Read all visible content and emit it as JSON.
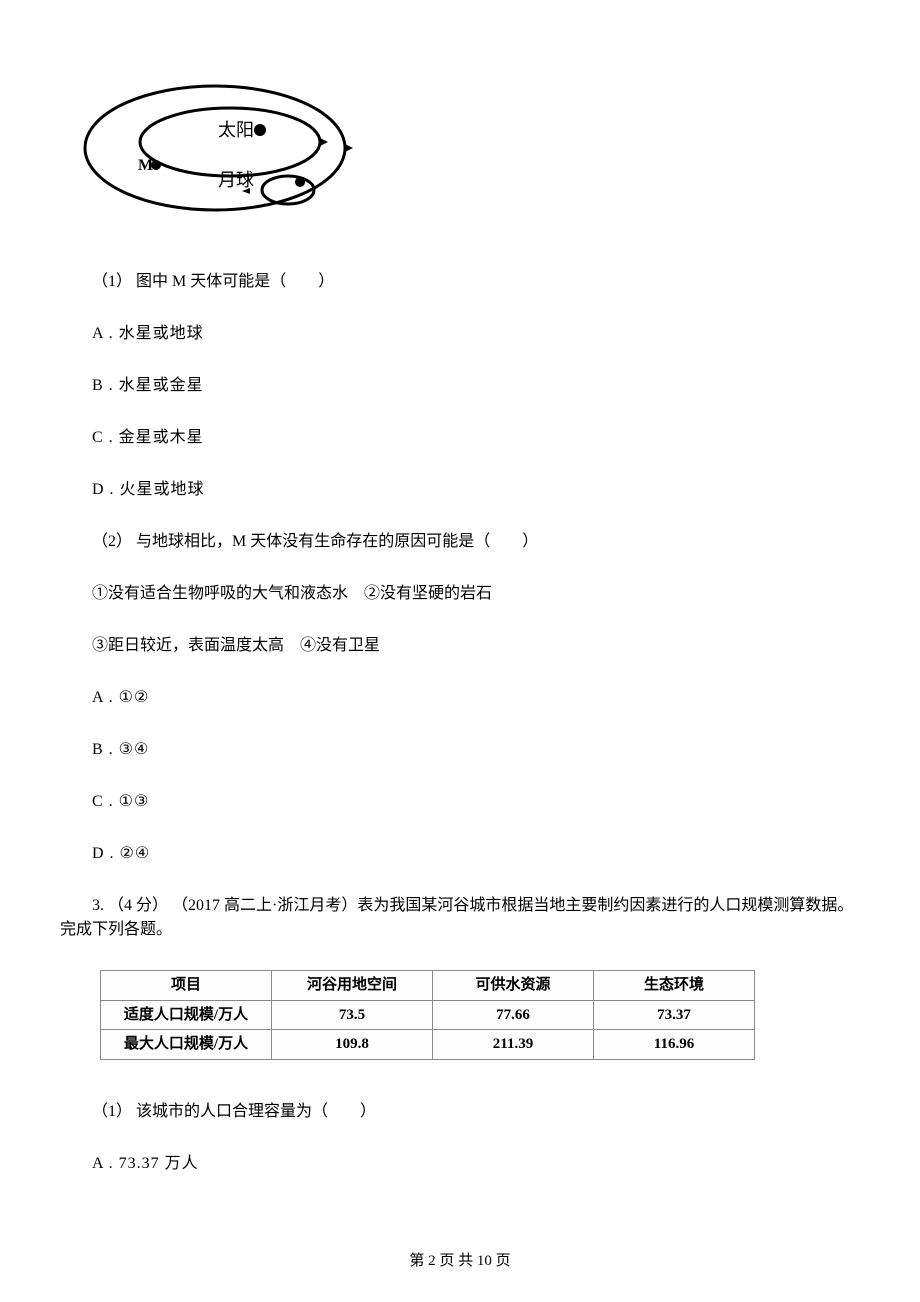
{
  "diagram": {
    "sun_label": "太阳",
    "moon_label": "月球",
    "m_label": "M"
  },
  "q2": {
    "sub1": {
      "prompt": "（1） 图中 M 天体可能是（　　）",
      "A": "A . 水星或地球",
      "B": "B . 水星或金星",
      "C": "C . 金星或木星",
      "D": "D . 火星或地球"
    },
    "sub2": {
      "prompt": "（2） 与地球相比，M 天体没有生命存在的原因可能是（　　）",
      "cond_line1": "①没有适合生物呼吸的大气和液态水　②没有坚硬的岩石",
      "cond_line2": "③距日较近，表面温度太高　④没有卫星",
      "A": "A . ①②",
      "B": "B . ③④",
      "C": "C . ①③",
      "D": "D . ②④"
    }
  },
  "q3": {
    "lead": "3. （4 分） （2017 高二上·浙江月考）表为我国某河谷城市根据当地主要制约因素进行的人口规模测算数据。完成下列各题。",
    "table": {
      "headers": [
        "项目",
        "河谷用地空间",
        "可供水资源",
        "生态环境"
      ],
      "rows": [
        {
          "label": "适度人口规模/万人",
          "v1": "73.5",
          "v2": "77.66",
          "v3": "73.37"
        },
        {
          "label": "最大人口规模/万人",
          "v1": "109.8",
          "v2": "211.39",
          "v3": "116.96"
        }
      ]
    },
    "sub1": {
      "prompt": "（1） 该城市的人口合理容量为（　　）",
      "A": "A . 73.37 万人"
    }
  },
  "footer": "第 2 页 共 10 页"
}
